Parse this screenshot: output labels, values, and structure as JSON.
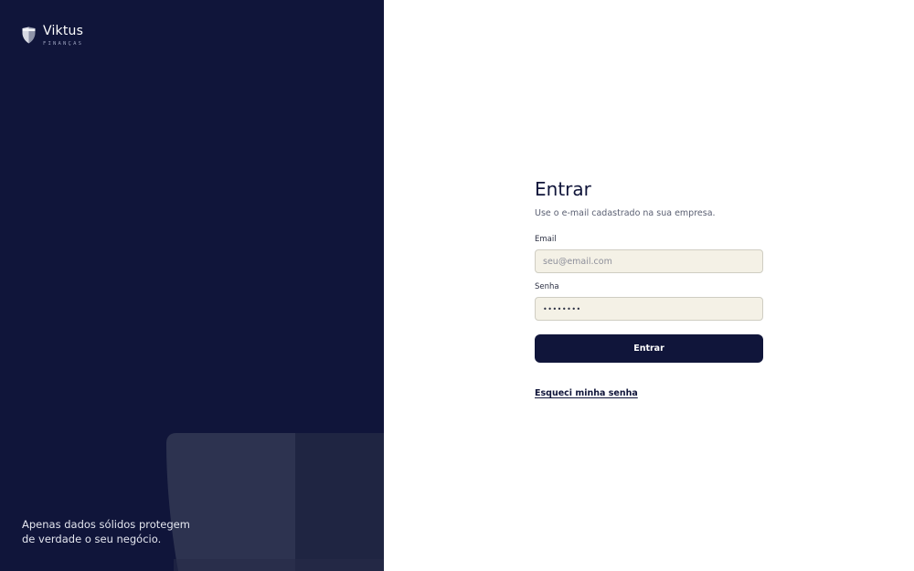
{
  "brand": {
    "name": "Viktus",
    "subtitle": "FINANÇAS",
    "logo_icon": "shield-icon"
  },
  "tagline": "Apenas dados sólidos protegem de verdade o seu negócio.",
  "login": {
    "title": "Entrar",
    "subtitle": "Use o e-mail cadastrado na sua empresa.",
    "email_label": "Email",
    "email_placeholder": "seu@email.com",
    "password_label": "Senha",
    "password_value": "••••••••",
    "submit_label": "Entrar",
    "forgot_label": "Esqueci minha senha"
  },
  "colors": {
    "navy": "#10153a",
    "input_bg": "#f4f1e6",
    "white": "#ffffff"
  }
}
